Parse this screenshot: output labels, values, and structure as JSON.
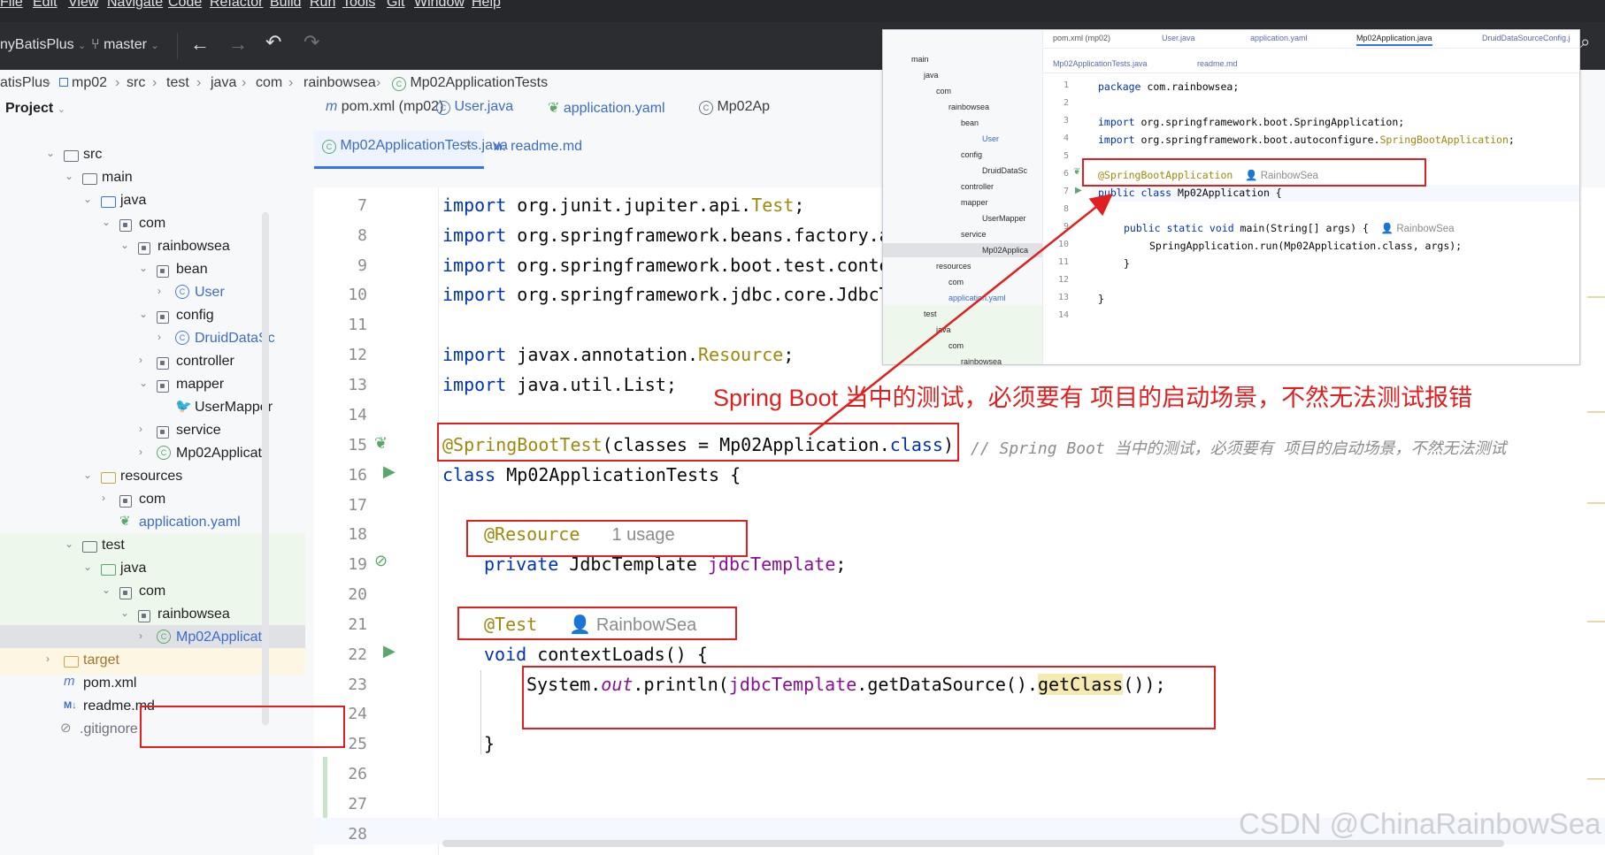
{
  "menu": [
    "File",
    "Edit",
    "View",
    "Navigate",
    "Code",
    "Refactor",
    "Build",
    "Run",
    "Tools",
    "Git",
    "Window",
    "Help"
  ],
  "toolbar": {
    "project": "nyBatisPlus",
    "branch": "master"
  },
  "breadcrumb": [
    "atisPlus",
    "mp02",
    "src",
    "test",
    "java",
    "com",
    "rainbowsea",
    "Mp02ApplicationTests"
  ],
  "project_panel": {
    "title": "Project",
    "tree": [
      {
        "label": "src",
        "indent": 0,
        "type": "folder",
        "expanded": true
      },
      {
        "label": "main",
        "indent": 1,
        "type": "folder",
        "expanded": true
      },
      {
        "label": "java",
        "indent": 2,
        "type": "source",
        "expanded": true
      },
      {
        "label": "com",
        "indent": 3,
        "type": "package",
        "expanded": true
      },
      {
        "label": "rainbowsea",
        "indent": 4,
        "type": "package",
        "expanded": true
      },
      {
        "label": "bean",
        "indent": 5,
        "type": "package",
        "expanded": true
      },
      {
        "label": "User",
        "indent": 6,
        "type": "class",
        "expanded": false
      },
      {
        "label": "config",
        "indent": 5,
        "type": "package",
        "expanded": true
      },
      {
        "label": "DruidDataSc",
        "indent": 6,
        "type": "class",
        "expanded": false
      },
      {
        "label": "controller",
        "indent": 5,
        "type": "package",
        "expanded": false
      },
      {
        "label": "mapper",
        "indent": 5,
        "type": "package",
        "expanded": true
      },
      {
        "label": "UserMapper",
        "indent": 6,
        "type": "mapper",
        "expanded": false
      },
      {
        "label": "service",
        "indent": 5,
        "type": "package",
        "expanded": false
      },
      {
        "label": "Mp02Applicati",
        "indent": 5,
        "type": "springclass",
        "expanded": false
      },
      {
        "label": "resources",
        "indent": 2,
        "type": "resources",
        "expanded": true
      },
      {
        "label": "com",
        "indent": 3,
        "type": "package",
        "expanded": false
      },
      {
        "label": "application.yaml",
        "indent": 3,
        "type": "yaml",
        "expanded": false
      },
      {
        "label": "test",
        "indent": 1,
        "type": "folder",
        "expanded": true
      },
      {
        "label": "java",
        "indent": 2,
        "type": "testsource",
        "expanded": true
      },
      {
        "label": "com",
        "indent": 3,
        "type": "package",
        "expanded": true
      },
      {
        "label": "rainbowsea",
        "indent": 4,
        "type": "package",
        "expanded": true
      },
      {
        "label": "Mp02Applicati",
        "indent": 5,
        "type": "testclass",
        "expanded": false
      },
      {
        "label": "target",
        "indent": 0,
        "type": "target",
        "expanded": false
      },
      {
        "label": "pom.xml",
        "indent": 0,
        "type": "maven",
        "expanded": false
      },
      {
        "label": "readme.md",
        "indent": 0,
        "type": "md",
        "expanded": false
      },
      {
        "label": ".gitignore",
        "indent": -1,
        "type": "ignore",
        "expanded": false
      }
    ]
  },
  "editor_tabs": {
    "row1": [
      "pom.xml (mp02)",
      "User.java",
      "application.yaml",
      "Mp02Ap"
    ],
    "row2": [
      "Mp02ApplicationTests.java",
      "readme.md"
    ]
  },
  "editor": {
    "line_numbers": [
      "7",
      "8",
      "9",
      "10",
      "11",
      "12",
      "13",
      "14",
      "15",
      "16",
      "17",
      "18",
      "19",
      "20",
      "21",
      "22",
      "23",
      "24",
      "25",
      "26",
      "27",
      "28"
    ],
    "lines": {
      "l7_kw": "import",
      "l7_rest": " org.junit.jupiter.api.",
      "l7_ann": "Test",
      "l7_end": ";",
      "l8_kw": "import",
      "l8_rest": " org.springframework.beans.factory.a",
      "l9_kw": "import",
      "l9_rest": " org.springframework.boot.test.conte",
      "l10_kw": "import",
      "l10_rest": " org.springframework.jdbc.core.JdbcT",
      "l12_kw": "import",
      "l12_rest": " javax.annotation.",
      "l12_ann": "Resource",
      "l12_end": ";",
      "l13_kw": "import",
      "l13_rest": " java.util.List;",
      "l15_ann": "@SpringBootTest",
      "l15_rest": "(classes = Mp02Application.",
      "l15_kw": "class",
      "l15_end": ")",
      "l15_comment": "// Spring Boot 当中的测试，必须要有 项目的启动场景，不然无法测试",
      "l16_kw": "class",
      "l16_rest": " Mp02ApplicationTests {",
      "l18_ann": "@Resource",
      "l18_hint": "1 usage",
      "l19_kw": "private",
      "l19_rest": " JdbcTemplate ",
      "l19_fld": "jdbcTemplate",
      "l19_end": ";",
      "l21_ann": "@Test",
      "l21_hint": "RainbowSea",
      "l22_kw": "void",
      "l22_rest": " contextLoads() {",
      "l23_a": "System.",
      "l23_out": "out",
      "l23_b": ".println(",
      "l23_fld": "jdbcTemplate",
      "l23_c": ".getDataSource().",
      "l23_gc": "getClass",
      "l23_d": "());",
      "l25": "}"
    }
  },
  "annotation_text": "Spring Boot 当中的测试，必须要有 项目的启动场景，不然无法测试报错",
  "overlay": {
    "tabs": [
      "pom.xml (mp02)",
      "User.java",
      "application.yaml",
      "Mp02Application.java",
      "DruidDataSourceConfig.j"
    ],
    "tabs2": [
      "Mp02ApplicationTests.java",
      "readme.md"
    ],
    "tree": [
      "main",
      "java",
      "com",
      "rainbowsea",
      "bean",
      "User",
      "config",
      "DruidDataSc",
      "controller",
      "mapper",
      "UserMapper",
      "service",
      "Mp02Applica",
      "resources",
      "com",
      "application.yaml",
      "test",
      "java",
      "com",
      "rainbowsea"
    ],
    "line_numbers": [
      "1",
      "2",
      "3",
      "4",
      "5",
      "6",
      "7",
      "8",
      "9",
      "10",
      "11",
      "12",
      "13",
      "14"
    ],
    "code": {
      "l1_kw": "package",
      "l1_rest": " com.rainbowsea;",
      "l3_kw": "import",
      "l3_rest": " org.springframework.boot.SpringApplication;",
      "l4_kw": "import",
      "l4_rest": " org.springframework.boot.autoconfigure.",
      "l4_ann": "SpringBootApplication",
      "l4_end": ";",
      "l6_ann": "@SpringBootApplication",
      "l6_hint": "RainbowSea",
      "l7_kw": "public class",
      "l7_rest": " Mp02Application {",
      "l9_kw": "public static void",
      "l9_rest": " main(String[] args) {",
      "l9_hint": "RainbowSea",
      "l10": "SpringApplication.run(Mp02Application.class, args);",
      "l11": "}",
      "l13": "}"
    }
  },
  "watermark": "CSDN @ChinaRainbowSea"
}
